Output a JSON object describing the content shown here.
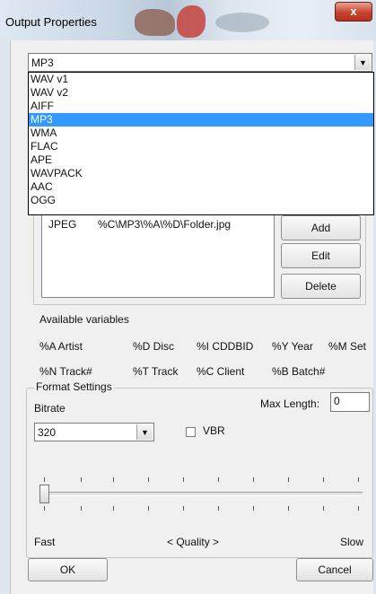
{
  "window": {
    "title": "Output Properties",
    "close_glyph": "x"
  },
  "format": {
    "selected": "MP3",
    "arrow_glyph": "▼",
    "options": [
      "WAV v1",
      "WAV v2",
      "AIFF",
      "MP3",
      "WMA",
      "FLAC",
      "APE",
      "WAVPACK",
      "AAC",
      "OGG"
    ]
  },
  "artwork": {
    "row": {
      "type": "JPEG",
      "path": "%C\\MP3\\%A\\%D\\Folder.jpg"
    },
    "add_label": "Add",
    "edit_label": "Edit",
    "delete_label": "Delete"
  },
  "variables": {
    "label": "Available variables",
    "items": [
      "%A Artist",
      "%D Disc",
      "%I CDDBID",
      "%Y Year",
      "%M Set",
      "%N Track#",
      "%T Track",
      "%C Client",
      "%B Batch#"
    ]
  },
  "format_settings": {
    "group_label": "Format Settings",
    "bitrate_label": "Bitrate",
    "bitrate_value": "320",
    "max_length_label": "Max Length:",
    "max_length_value": "0",
    "vbr_label": "VBR",
    "vbr_checked": false,
    "quality_fast": "Fast",
    "quality_label": "<  Quality  >",
    "quality_slow": "Slow",
    "quality_position": 0
  },
  "buttons": {
    "ok": "OK",
    "cancel": "Cancel"
  },
  "colors": {
    "selection": "#3399ff",
    "close_button": "#c7432e"
  }
}
